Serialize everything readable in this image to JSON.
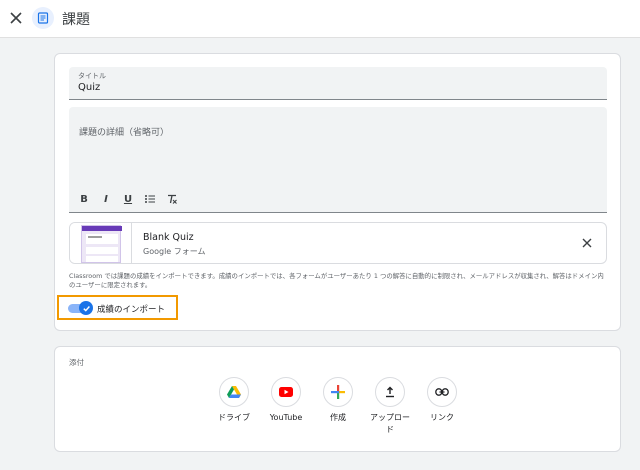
{
  "header": {
    "title": "課題",
    "close_icon": "close-icon",
    "assignment_icon": "assignment-icon"
  },
  "form": {
    "title_label": "タイトル",
    "title_value": "Quiz",
    "details_placeholder": "課題の詳細（省略可）",
    "format_buttons": [
      {
        "icon": "bold-icon",
        "glyph": "B"
      },
      {
        "icon": "italic-icon",
        "glyph": "I"
      },
      {
        "icon": "underline-icon",
        "glyph": "U"
      },
      {
        "icon": "bulleted-list-icon",
        "glyph": ""
      },
      {
        "icon": "clear-formatting-icon",
        "glyph": ""
      }
    ]
  },
  "attachment": {
    "title": "Blank Quiz",
    "subtitle": "Google フォーム"
  },
  "note": "Classroom では課題の成績をインポートできます。成績のインポートでは、各フォームがユーザーあたり 1 つの解答に自動的に制限され、メールアドレスが収集され、解答はドメイン内のユーザーに限定されます。",
  "grade_import": {
    "label": "成績のインポート",
    "enabled": true,
    "accent": "#1a73e8"
  },
  "attach_section": {
    "heading": "添付",
    "buttons": [
      {
        "id": "drive",
        "label": "ドライブ",
        "icon": "google-drive-icon"
      },
      {
        "id": "youtube",
        "label": "YouTube",
        "icon": "youtube-icon"
      },
      {
        "id": "create",
        "label": "作成",
        "icon": "plus-icon"
      },
      {
        "id": "upload",
        "label": "アップロード",
        "icon": "upload-icon"
      },
      {
        "id": "link",
        "label": "リンク",
        "icon": "link-icon"
      }
    ]
  }
}
